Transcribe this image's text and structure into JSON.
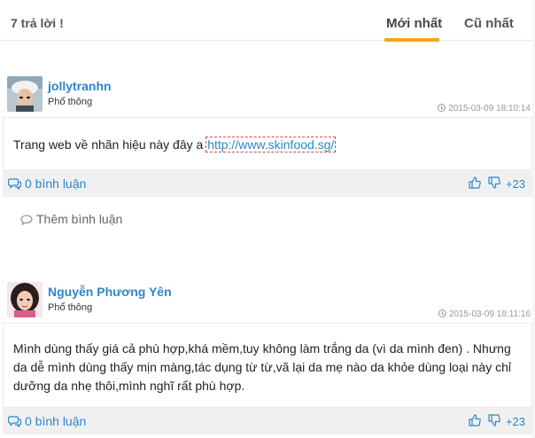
{
  "header": {
    "reply_count": "7 trả lời !",
    "tabs": [
      {
        "label": "Mới nhất",
        "active": true
      },
      {
        "label": "Cũ nhất",
        "active": false
      }
    ],
    "accent_color": "#f7a21b"
  },
  "comments": [
    {
      "username": "jollytranhn",
      "rank": "Phổ thông",
      "timestamp": "2015-03-09 18:10:14",
      "body_prefix": "Trang web về nhãn hiệu này đây a ",
      "link_text": "http://www.skinfood.sg/",
      "comment_count_label": "0 bình luận",
      "score": "+23",
      "add_comment_label": "Thêm bình luận"
    },
    {
      "username": "Nguyễn Phương Yên",
      "rank": "Phổ thông",
      "timestamp": "2015-03-09 18:11:16",
      "body": "Mình dùng thấy giá cả phù hợp,khá mềm,tuy không làm trắng da (vì da mình đen) . Nhưng da dễ mình dùng thấy mịn màng,tác dụng từ từ,vã lại da mẹ nào da khỏe dùng loại này chỉ dưỡng da nhẹ thôi,mình nghĩ rất phù hợp.",
      "comment_count_label": "0 bình luận",
      "score": "+23"
    }
  ],
  "icons": {
    "clock": "clock-icon",
    "comment": "comment-icon",
    "like": "thumbs-up-icon",
    "dislike": "thumbs-down-icon",
    "add_comment": "speech-bubble-icon"
  },
  "colors": {
    "link": "#2d86c9",
    "action_bar": "#f0f0f0"
  }
}
